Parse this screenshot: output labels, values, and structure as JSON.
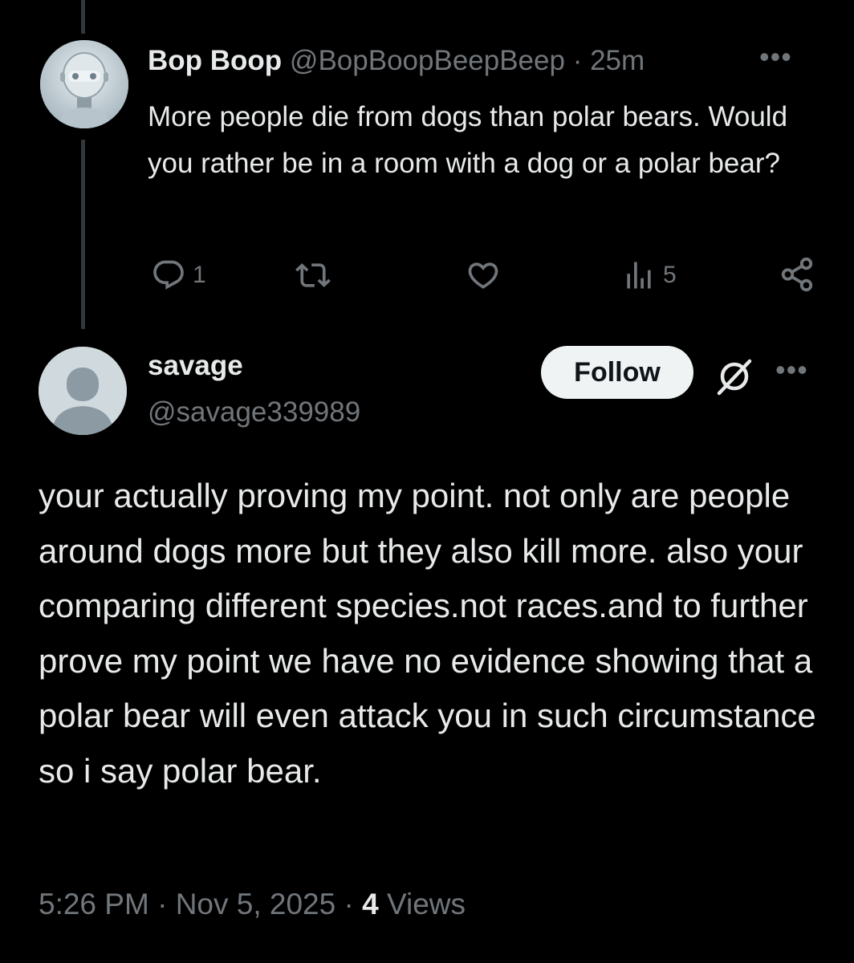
{
  "original_tweet": {
    "display_name": "Bop Boop",
    "handle": "@BopBoopBeepBeep",
    "separator": "·",
    "time": "25m",
    "more_label": "•••",
    "text": "More people die from dogs than polar bears. Would you rather be in a room with a dog or a polar bear?",
    "replies": "1",
    "views": "5",
    "icons": [
      "reply-icon",
      "retweet-icon",
      "like-icon",
      "views-icon",
      "share-icon"
    ]
  },
  "reply_tweet": {
    "display_name": "savage",
    "handle": "@savage339989",
    "follow_label": "Follow",
    "more_label": "•••",
    "text": "your actually proving my point. not only are people around dogs more but they also kill more. also your comparing different species.not races.and to further prove my point we have no evidence showing that a polar bear will even attack you in such circumstance so i say polar bear.",
    "time": "5:26 PM",
    "sep1": "·",
    "date": "Nov 5, 2025",
    "sep2": "·",
    "views_count": "4",
    "views_label": "Views"
  },
  "colors": {
    "background": "#000000",
    "primary_text": "#e7e9ea",
    "secondary_text": "#71767b",
    "follow_button_bg": "#eff3f4",
    "follow_button_text": "#0f1419"
  }
}
